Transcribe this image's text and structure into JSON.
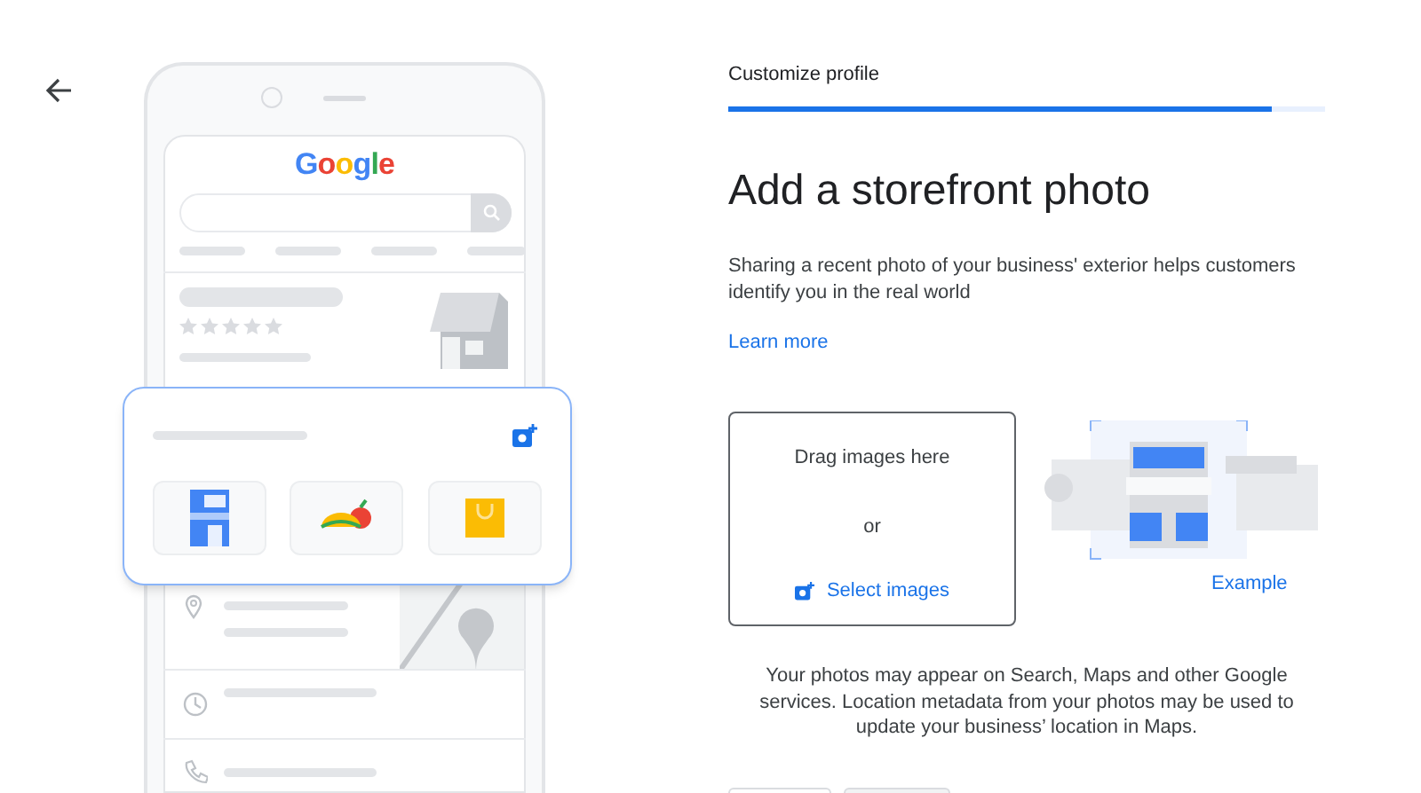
{
  "progress": {
    "label": "Customize profile",
    "level": 0.91
  },
  "heading": "Add a storefront photo",
  "description": "Sharing a recent photo of your business' exterior helps customers identify you in the real world",
  "learn_more": "Learn more",
  "upload": {
    "drag_text": "Drag images here",
    "or_text": "or",
    "select_button": "Select images"
  },
  "example_label": "Example",
  "illustration": {
    "logo": "Google"
  },
  "disclaimer": "Your photos may appear on Search, Maps and other Google services. Location metadata from your photos may be used to update your business’ location in Maps."
}
